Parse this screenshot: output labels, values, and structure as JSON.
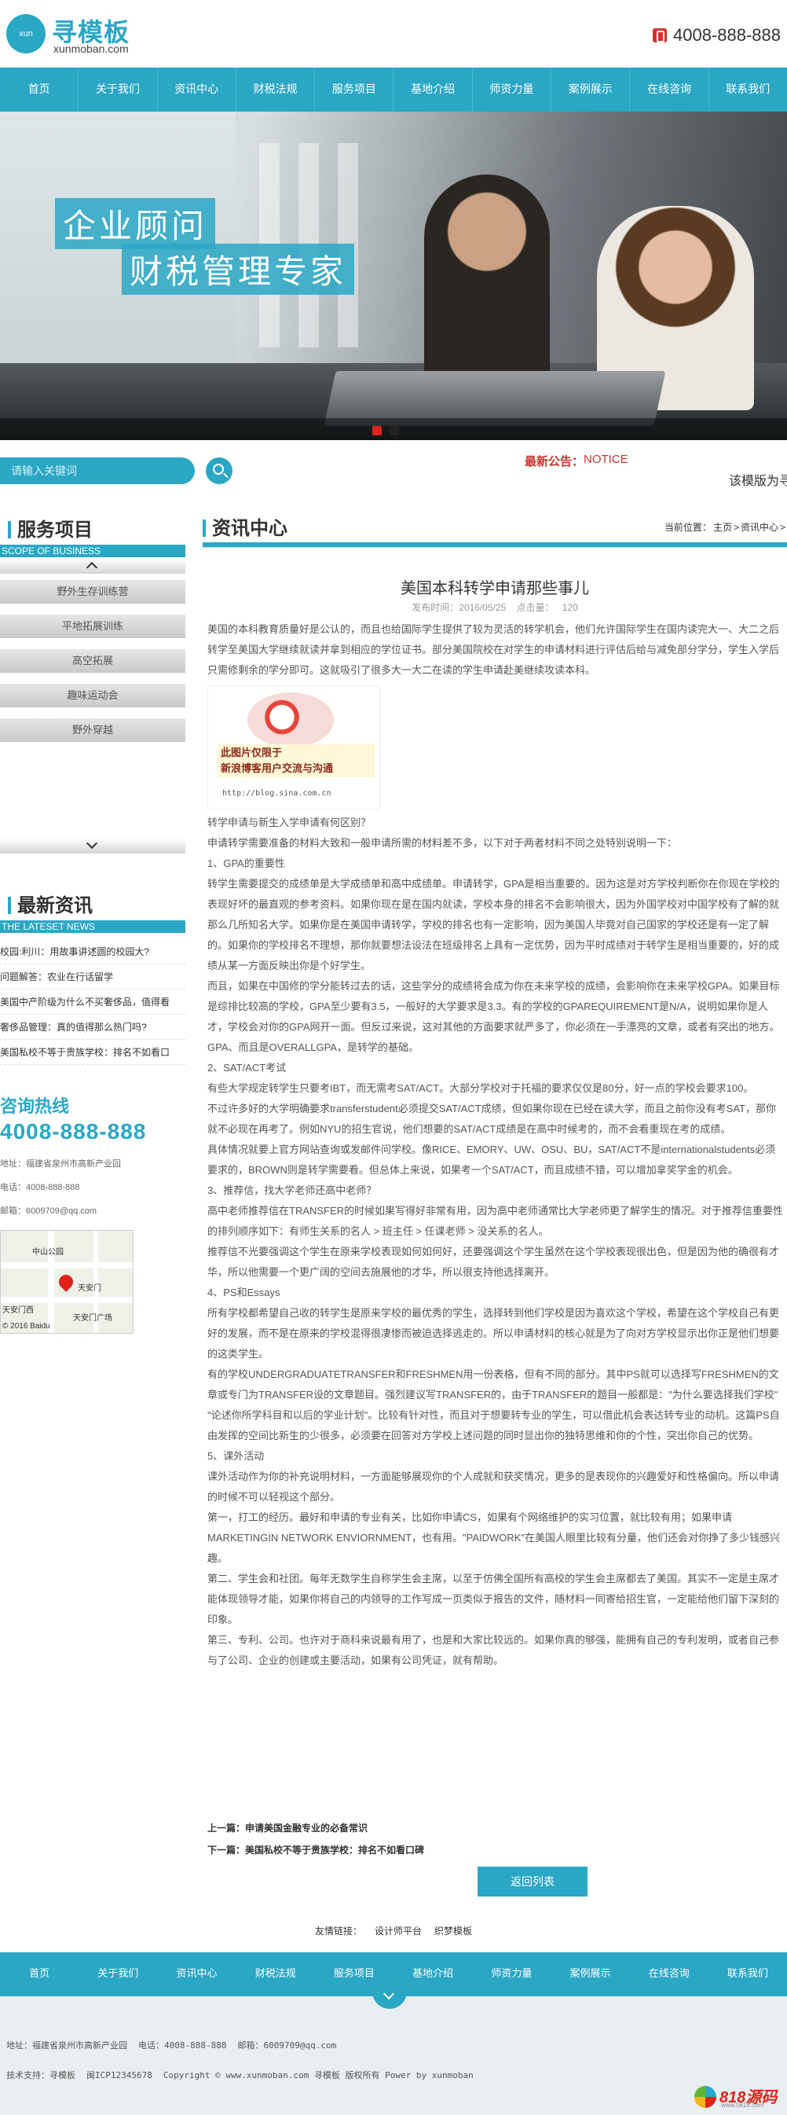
{
  "brand": {
    "logo_badge": "xun",
    "name_cn": "寻模板",
    "domain": "xunmoban.com",
    "accent": "#2aa7c5"
  },
  "header": {
    "phone": "4008-888-888"
  },
  "nav": [
    "首页",
    "关于我们",
    "资讯中心",
    "财税法规",
    "服务项目",
    "基地介绍",
    "师资力量",
    "案例展示",
    "在线咨询",
    "联系我们"
  ],
  "banner": {
    "line1": "企业顾问",
    "line2": "财税管理专家"
  },
  "search": {
    "placeholder": "请输入关键词"
  },
  "notice": {
    "label": "最新公告：",
    "en": "NOTICE",
    "text": "该模版为寻模板"
  },
  "sidebar": {
    "services_title": "服务项目",
    "services_sub": "SCOPE OF BUSINESS",
    "services": [
      "野外生存训练营",
      "平地拓展训练",
      "高空拓展",
      "趣味运动会",
      "野外穿越"
    ],
    "news_title": "最新资讯",
    "news_sub": "THE LATESET NEWS",
    "news": [
      "校园:利川：用故事讲述圆的校园大?",
      "问题解答：农业在行话留学",
      "美国中产阶级为什么不买奢侈品，值得看",
      "奢侈品管理：真的值得那么热门吗?",
      "美国私校不等于贵族学校：排名不如看口"
    ],
    "hotline_title": "咨询热线",
    "hotline": "4008-888-888",
    "address": "地址：福建省泉州市高新产业园",
    "tel": "电话：4008-888-888",
    "email": "邮箱：6009709@qq.com",
    "map_labels": [
      "中山公园",
      "天安门",
      "天安门西",
      "天安门广场",
      "© 2016 Baidu"
    ]
  },
  "main": {
    "title": "资讯中心",
    "crumb_label": "当前位置：",
    "crumb_home": "主页",
    "crumb_sep": ">",
    "crumb_current": "资讯中心",
    "article_title": "美国本科转学申请那些事儿",
    "meta_date_label": "发布时间：",
    "meta_date": "2016/05/25",
    "meta_hits_label": "点击量：",
    "meta_hits": "120",
    "p1": "美国的本科教育质量好是公认的，而且也给国际学生提供了较为灵活的转学机会，他们允许国际学生在国内读完大一、大二之后转学至美国大学继续就读并拿到相应的学位证书。部分美国院校在对学生的申请材料进行评估后给与减免部分学分，学生入学后只需修剩余的学分即可。这就吸引了很多大一大二在读的学生申请赴美继续攻读本科。",
    "img_cap1": "此图片仅限于",
    "img_cap2": "新浪博客用户交流与沟通",
    "img_url": "http://blog.sina.com.cn",
    "q1": "转学申请与新生入学申请有何区别？",
    "p2": "申请转学需要准备的材料大致和一般申请所需的材料差不多，以下对于两者材料不同之处特别说明一下：",
    "h1": "1、GPA的重要性",
    "p3": "转学生需要提交的成绩单是大学成绩单和高中成绩单。申请转学，GPA是相当重要的。因为这是对方学校判断你在你现在学校的表现好坏的最直观的参考资料。如果你现在是在国内就读，学校本身的排名不会影响很大，因为外国学校对中国学校有了解的就那么几所知名大学。如果你是在美国申请转学，学校的排名也有一定影响，因为美国人毕竟对自己国家的学校还是有一定了解的。如果你的学校排名不理想，那你就要想法设法在班级排名上具有一定优势，因为平时成绩对于转学生是相当重要的，好的成绩从某一方面反映出你是个好学生。",
    "p4": "而且，如果在中国修的学分能转过去的话，这些学分的成绩将会成为你在未来学校的成绩，会影响你在未来学校GPA。如果目标是综排比较高的学校，GPA至少要有3.5，一般好的大学要求是3.3。有的学校的GPAREQUIREMENT是N/A，说明如果你是人才，学校会对你的GPA网开一面。但反过来说，这对其他的方面要求就严多了，你必须在一手漂亮的文章，或者有突出的地方。GPA、而且是OVERALLGPA，是转学的基础。",
    "h2": "2、SAT/ACT考试",
    "p5": "有些大学规定转学生只要考IBT，而无需考SAT/ACT。大部分学校对于托福的要求仅仅是80分，好一点的学校会要求100。",
    "p6": "不过许多好的大学明确要求transferstudent必须提交SAT/ACT成绩，但如果你现在已经在读大学，而且之前你没有考SAT，那你就不必现在再考了。例如NYU的招生官说，他们想要的SAT/ACT成绩是在高中时候考的，而不会看重现在考的成绩。",
    "p7": "具体情况就要上官方网站查询或发邮件问学校。像RICE、EMORY、UW、OSU、BU，SAT/ACT不是internationalstudents必须要求的，BROWN则是转学需要看。但总体上来说，如果考一个SAT/ACT，而且成绩不错，可以增加拿奖学金的机会。",
    "h3": "3、推荐信，找大学老师还高中老师？",
    "p8": "高中老师推荐信在TRANSFER的时候如果写得好非常有用，因为高中老师通常比大学老师更了解学生的情况。对于推荐信重要性的排列顺序如下：有师生关系的名人 > 班主任 > 任课老师 > 没关系的名人。",
    "p9": "推荐信不光要强调这个学生在原来学校表现如何如何好，还要强调这个学生虽然在这个学校表现很出色，但是因为他的确很有才华，所以他需要一个更广阔的空间去施展他的才华，所以很支持他选择离开。",
    "h4": "4、PS和Essays",
    "p10": "所有学校都希望自己收的转学生是原来学校的最优秀的学生，选择转到他们学校是因为喜欢这个学校，希望在这个学校自己有更好的发展，而不是在原来的学校混得很凄惨而被迫选择逃走的。所以申请材料的核心就是为了向对方学校显示出你正是他们想要的这类学生。",
    "p11": "有的学校UNDERGRADUATETRANSFER和FRESHMEN用一份表格，但有不同的部分。其中PS就可以选择写FRESHMEN的文章或专门为TRANSFER设的文章题目。强烈建议写TRANSFER的，由于TRANSFER的题目一般都是：\"为什么要选择我们学校\" \"论述你所学科目和以后的学业计划\"。比较有针对性，而且对于想要转专业的学生，可以借此机会表达转专业的动机。这篇PS自由发挥的空间比新生的少很多，必须要在回答对方学校上述问题的同时显出你的独特思维和你的个性，突出你自己的优势。",
    "h5": "5、课外活动",
    "p12": "课外活动作为你的补充说明材料，一方面能够展现你的个人成就和获奖情况，更多的是表现你的兴趣爱好和性格偏向。所以申请的时候不可以轻视这个部分。",
    "p13": "第一，打工的经历。最好和申请的专业有关，比如你申请CS，如果有个网络维护的实习位置，就比较有用；如果申请MARKETINGIN NETWORK ENVIORNMENT，也有用。\"PAIDWORK\"在美国人眼里比较有分量，他们还会对你挣了多少钱感兴趣。",
    "p14": "第二、学生会和社团。每年无数学生自称学生会主席，以至于仿佛全国所有高校的学生会主席都去了美国。其实不一定是主席才能体现领导才能，如果你将自己的内领导的工作写成一页类似于报告的文件，随材料一同寄给招生官，一定能给他们留下深刻的印象。",
    "p15": "第三、专利、公司。也许对于商科来说最有用了，也是和大家比较远的。如果你真的够强，能拥有自己的专利发明，或者自己参与了公司、企业的创建或主要活动，如果有公司凭证，就有帮助。",
    "prev": "上一篇：申请美国金融专业的必备常识",
    "next": "下一篇：美国私校不等于贵族学校：排名不如看口碑",
    "back": "返回列表"
  },
  "links": {
    "label": "友情链接：",
    "items": [
      "设计师平台",
      "织梦模板"
    ]
  },
  "footer": {
    "nav": [
      "首页",
      "关于我们",
      "资讯中心",
      "财税法规",
      "服务项目",
      "基地介绍",
      "师资力量",
      "案例展示",
      "在线咨询",
      "联系我们"
    ],
    "address": "地址：福建省泉州市高新产业园",
    "tel": "电话：4008-888-888",
    "email": "邮箱：6009709@qq.com",
    "support": "技术支持：寻模板",
    "icp": "闽ICP12345678",
    "copyright": "Copyright © www.xunmoban.com 寻模板 版权所有 Power by xunmoban",
    "badge": "818源码",
    "badge_sub": "www.0818.com"
  }
}
